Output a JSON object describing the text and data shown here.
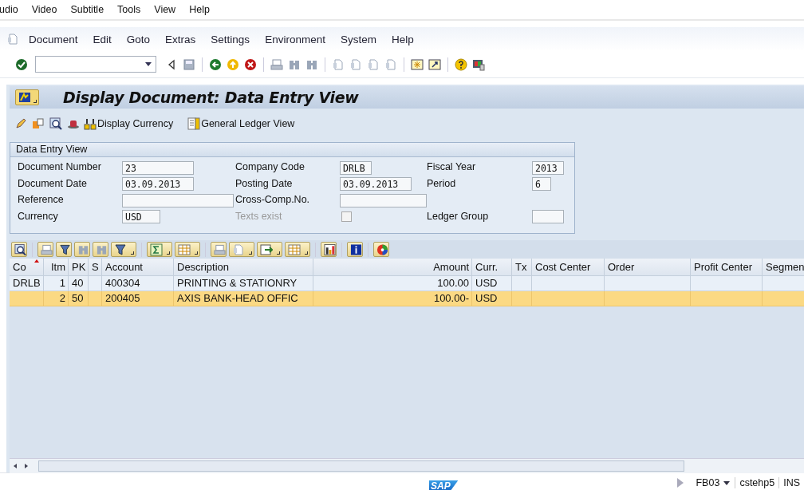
{
  "host_menu": [
    "udio",
    "Video",
    "Subtitle",
    "Tools",
    "View",
    "Help"
  ],
  "menu": [
    "Document",
    "Edit",
    "Goto",
    "Extras",
    "Settings",
    "Environment",
    "System",
    "Help"
  ],
  "title": "Display Document: Data Entry View",
  "app_buttons": [
    "Display Currency",
    "General Ledger View"
  ],
  "group": {
    "title": "Data Entry View",
    "fields": [
      {
        "kind": "text",
        "label": "Document Number",
        "value": "23"
      },
      {
        "kind": "text",
        "label": "Company Code",
        "value": "DRLB"
      },
      {
        "kind": "text",
        "label": "Fiscal Year",
        "value": "2013"
      },
      {
        "kind": "text",
        "label": "Document Date",
        "value": "03.09.2013"
      },
      {
        "kind": "text",
        "label": "Posting Date",
        "value": "03.09.2013"
      },
      {
        "kind": "text",
        "label": "Period",
        "value": "6"
      },
      {
        "kind": "text",
        "label": "Reference"
      },
      {
        "kind": "text",
        "label": "Cross-Comp.No."
      },
      {
        "kind": "empty"
      },
      {
        "kind": "text",
        "label": "Currency",
        "value": "USD"
      },
      {
        "kind": "checkbox",
        "label": "Texts exist",
        "checked": false,
        "disabled": true
      },
      {
        "kind": "text",
        "label": "Ledger Group"
      }
    ]
  },
  "grid": {
    "columns": [
      {
        "label": "Co",
        "sorted": true
      },
      {
        "label": "Itm",
        "sorted": false
      },
      {
        "label": "PK",
        "sorted": false
      },
      {
        "label": "S",
        "sorted": false
      },
      {
        "label": "Account",
        "sorted": false
      },
      {
        "label": "Description",
        "sorted": false
      },
      {
        "label": "Amount",
        "sorted": false
      },
      {
        "label": "Curr.",
        "sorted": false
      },
      {
        "label": "Tx",
        "sorted": false
      },
      {
        "label": "Cost Center",
        "sorted": false
      },
      {
        "label": "Order",
        "sorted": false
      },
      {
        "label": "Profit Center",
        "sorted": false
      },
      {
        "label": "Segmen",
        "sorted": false
      }
    ],
    "rows": [
      {
        "selected": false,
        "cells": [
          "DRLB",
          "1",
          "40",
          null,
          "400304",
          "PRINTING & STATIONRY",
          "100.00",
          "USD",
          null,
          null,
          null,
          null,
          null
        ]
      },
      {
        "selected": true,
        "cells": [
          null,
          "2",
          "50",
          null,
          "200405",
          "AXIS BANK-HEAD OFFIC",
          "100.00-",
          "USD",
          null,
          null,
          null,
          null,
          null
        ]
      }
    ]
  },
  "status_bar": {
    "logo": "SAP",
    "transaction": "FB03",
    "system": "cstehp5",
    "mode": "INS"
  }
}
